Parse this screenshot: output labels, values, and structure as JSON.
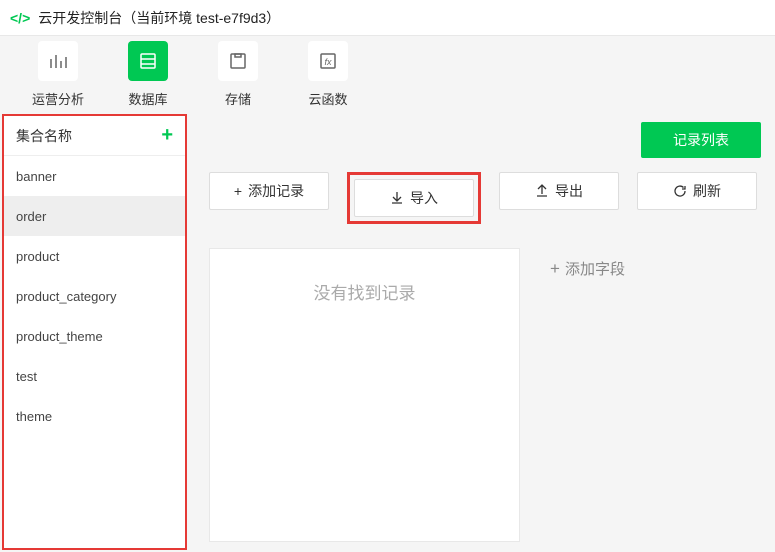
{
  "titlebar": {
    "title": "云开发控制台（当前环境 test-e7f9d3）"
  },
  "tabs": [
    {
      "label": "运营分析"
    },
    {
      "label": "数据库"
    },
    {
      "label": "存储"
    },
    {
      "label": "云函数"
    }
  ],
  "activeTab": 1,
  "sidebar": {
    "header": "集合名称",
    "items": [
      {
        "name": "banner"
      },
      {
        "name": "order"
      },
      {
        "name": "product"
      },
      {
        "name": "product_category"
      },
      {
        "name": "product_theme"
      },
      {
        "name": "test"
      },
      {
        "name": "theme"
      }
    ],
    "selected": 1
  },
  "buttons": {
    "recordList": "记录列表",
    "addRecord": "添加记录",
    "import": "导入",
    "export": "导出",
    "refresh": "刷新",
    "addField": "添加字段"
  },
  "emptyText": "没有找到记录"
}
